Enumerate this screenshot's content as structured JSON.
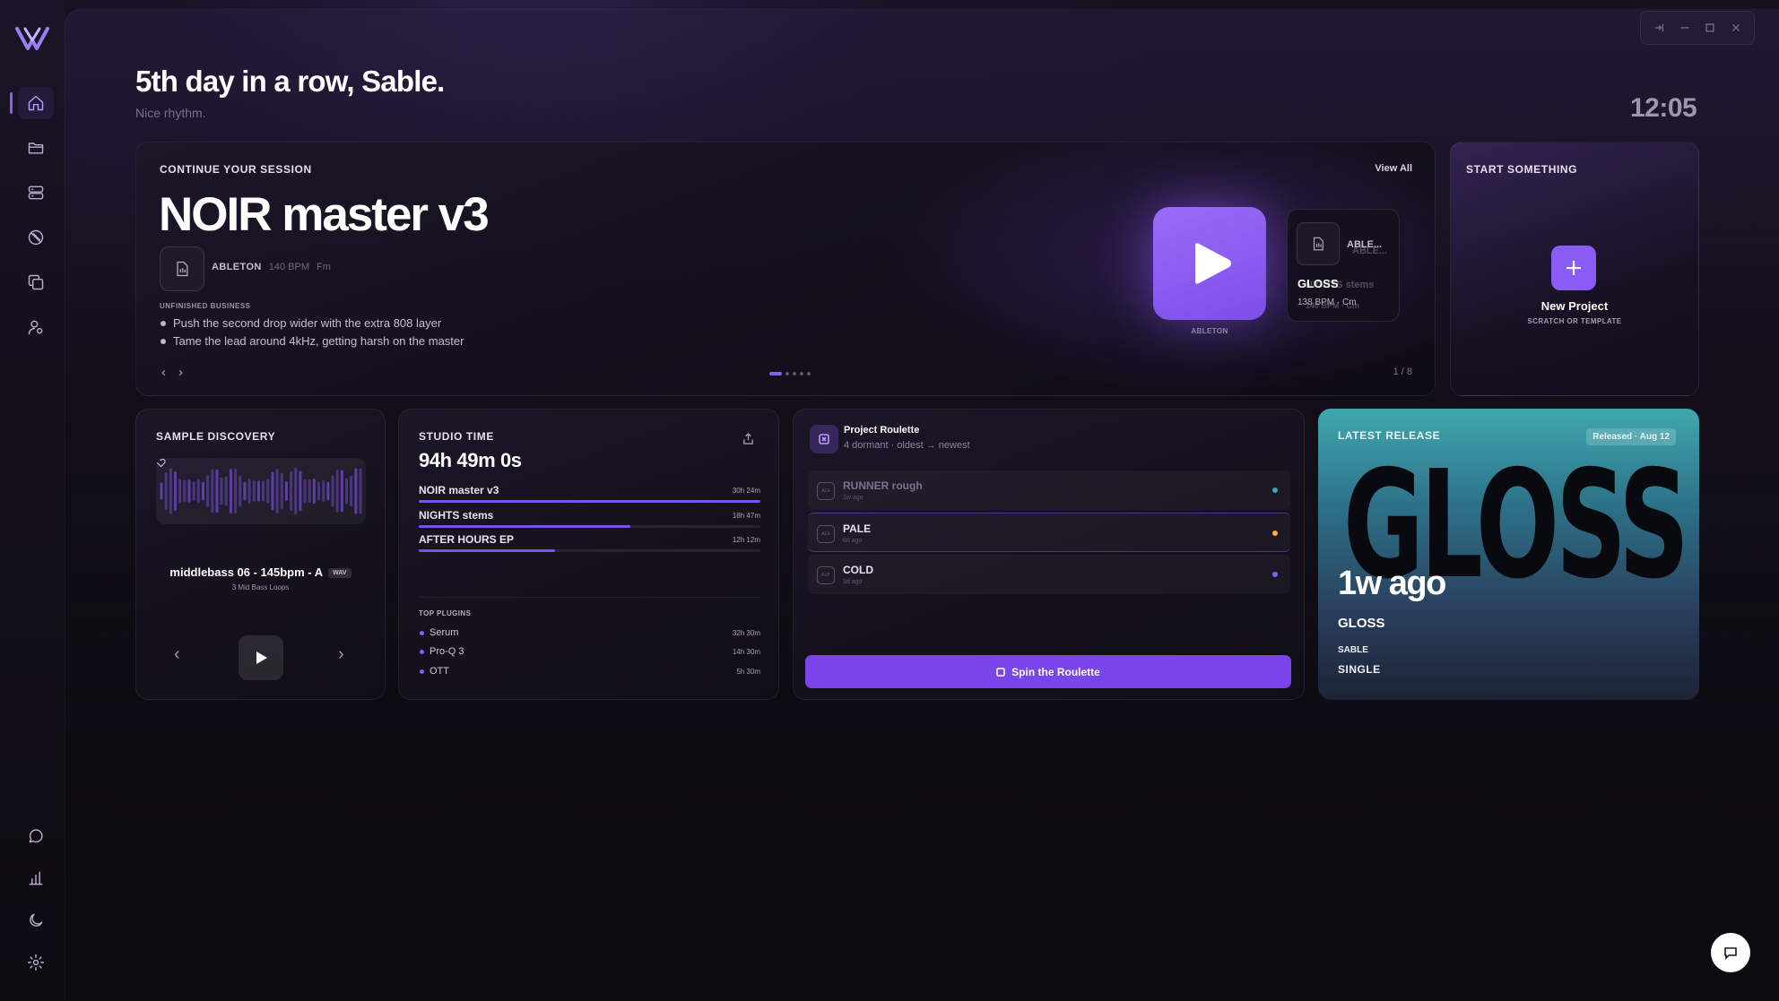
{
  "header": {
    "greeting": "5th day in a row, Sable.",
    "subtitle": "Nice rhythm.",
    "clock": "12:05"
  },
  "sidebar": {
    "items": [
      {
        "icon": "home-icon",
        "active": true
      },
      {
        "icon": "folder-icon"
      },
      {
        "icon": "server-icon"
      },
      {
        "icon": "tag-off-icon"
      },
      {
        "icon": "copy-icon"
      },
      {
        "icon": "user-settings-icon"
      }
    ],
    "bottom": [
      {
        "icon": "message-icon"
      },
      {
        "icon": "bar-chart-icon"
      },
      {
        "icon": "moon-icon"
      },
      {
        "icon": "settings-icon"
      }
    ]
  },
  "session": {
    "label": "Continue your session",
    "view_all": "View All",
    "title": "NOIR master v3",
    "daw": "ABLETON",
    "bpm": "140 BPM",
    "key": "Fm",
    "unfinished_label": "UNFINISHED BUSINESS",
    "tasks": [
      "Push the second drop wider with the extra 808 layer",
      "Tame the lead around 4kHz, getting harsh on the master"
    ],
    "play_caption": "ABLETON",
    "pager": "1 / 8",
    "next_card": {
      "daw": "ABLE...",
      "name": "GLOSS",
      "meta": "138 BPM · Cm",
      "ghost_daw": "ABLE...",
      "ghost_name": "NIGHTS stems",
      "ghost_meta": "140 BPM · Cm"
    }
  },
  "start": {
    "label": "Start something",
    "title": "New Project",
    "subtitle": "SCRATCH OR TEMPLATE"
  },
  "sample": {
    "label": "Sample Discovery",
    "name": "middlebass 06 - 145bpm - A",
    "format": "WAV",
    "pack": "3 Mid Bass Loops"
  },
  "studio": {
    "label": "Studio Time",
    "total": "94h 49m 0s",
    "projects": [
      {
        "name": "NOIR master v3",
        "time": "30h 24m",
        "fraction": 1.0
      },
      {
        "name": "NIGHTS stems",
        "time": "18h 47m",
        "fraction": 0.62
      },
      {
        "name": "AFTER HOURS EP",
        "time": "12h 12m",
        "fraction": 0.4
      }
    ],
    "plugins_label": "TOP PLUGINS",
    "plugins": [
      {
        "name": "Serum",
        "time": "32h 30m"
      },
      {
        "name": "Pro-Q 3",
        "time": "14h 30m"
      },
      {
        "name": "OTT",
        "time": "5h 30m"
      }
    ]
  },
  "roulette": {
    "title": "Project Roulette",
    "subtitle": "4 dormant · oldest → newest",
    "items": [
      {
        "name": "RUNNER rough",
        "age": "1w ago",
        "color": "#3aa6b9",
        "tag": "ALS"
      },
      {
        "name": "PALE",
        "age": "6d ago",
        "color": "#f5b342",
        "tag": "ALS"
      },
      {
        "name": "COLD",
        "age": "3d ago",
        "color": "#8a5cf6",
        "tag": "FLP"
      }
    ],
    "button": "Spin the Roulette"
  },
  "release": {
    "label": "Latest Release",
    "badge": "Released · Aug 12",
    "art_text": "GLOSS",
    "ago": "1w ago",
    "name": "GLOSS",
    "artist": "SABLE",
    "type": "SINGLE"
  },
  "colors": {
    "accent": "#8a5cf6",
    "background": "#0d0b14"
  }
}
